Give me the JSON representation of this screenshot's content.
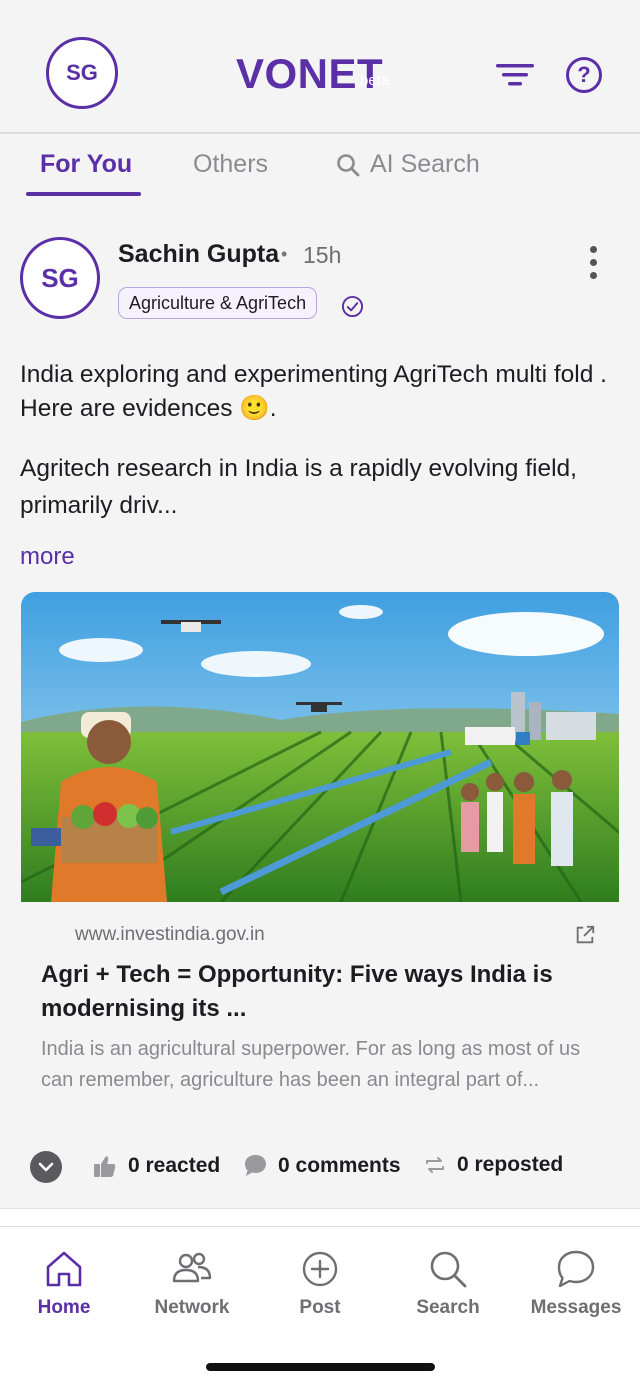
{
  "header": {
    "avatar_initials": "SG",
    "brand": "VONET",
    "brand_suffix": "beta",
    "filter_icon": "filter-lines-icon",
    "help_icon": "question-circle-icon"
  },
  "tabs": [
    {
      "label": "For You",
      "active": true
    },
    {
      "label": "Others",
      "active": false
    },
    {
      "label": "AI Search",
      "active": false,
      "icon": "search-icon"
    }
  ],
  "post": {
    "avatar_initials": "SG",
    "author": "Sachin Gupta",
    "separator": "•",
    "time": "15h",
    "tag": "Agriculture & AgriTech",
    "text_line1": "India exploring and experimenting AgriTech multi fold . Here are evidences 🙂.",
    "text_line2": "Agritech research in India is a rapidly evolving field, primarily driv...",
    "more_label": "more",
    "link": {
      "domain": "www.investindia.gov.in",
      "title": "Agri + Tech = Opportunity: Five ways India is modernising its ...",
      "description": "India is an agricultural superpower. For as long as most of us can remember, agriculture has been an integral part of..."
    },
    "reactions": "0 reacted",
    "comments": "0 comments",
    "reposts": "0 reposted"
  },
  "nav": [
    {
      "label": "Home",
      "icon": "home-icon",
      "active": true
    },
    {
      "label": "Network",
      "icon": "people-icon",
      "active": false
    },
    {
      "label": "Post",
      "icon": "plus-circle-icon",
      "active": false
    },
    {
      "label": "Search",
      "icon": "search-icon",
      "active": false
    },
    {
      "label": "Messages",
      "icon": "chat-bubble-icon",
      "active": false
    }
  ],
  "colors": {
    "accent": "#5b2fa6",
    "muted": "#8c8c90",
    "background": "#f4f4f5"
  }
}
